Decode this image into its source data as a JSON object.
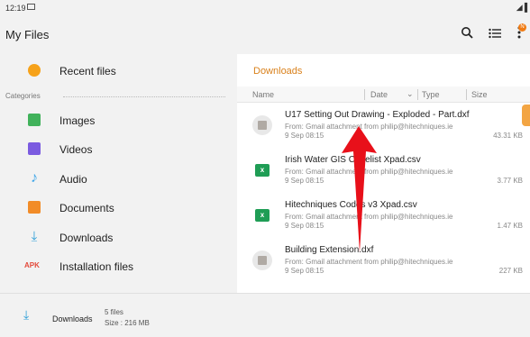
{
  "status": {
    "time": "12:19",
    "signal_text": "◢▐"
  },
  "appbar": {
    "title": "My Files",
    "notif_badge": "N"
  },
  "sidebar": {
    "items": [
      {
        "label": "Recent files",
        "icon": "clock-icon"
      },
      {
        "label": "Images",
        "icon": "image-icon"
      },
      {
        "label": "Videos",
        "icon": "play-icon"
      },
      {
        "label": "Audio",
        "icon": "music-note-icon"
      },
      {
        "label": "Documents",
        "icon": "document-icon"
      },
      {
        "label": "Downloads",
        "icon": "download-icon"
      },
      {
        "label": "Installation files",
        "icon": "apk-icon",
        "icon_text": "APK"
      }
    ],
    "categories_label": "Categories"
  },
  "content": {
    "breadcrumb": "Downloads",
    "columns": {
      "name": "Name",
      "date": "Date",
      "type": "Type",
      "size": "Size"
    },
    "files": [
      {
        "name": "U17 Setting Out Drawing - Exploded - Part.dxf",
        "source": "From: Gmail attachment from philip@hitechniques.ie",
        "date": "9 Sep 08:15",
        "size": "43.31 KB",
        "kind": "generic"
      },
      {
        "name": "Irish Water GIS Codelist Xpad.csv",
        "source": "From: Gmail attachment from philip@hitechniques.ie",
        "date": "9 Sep 08:15",
        "size": "3.77 KB",
        "kind": "spreadsheet"
      },
      {
        "name": "Hitechniques Codes v3 Xpad.csv",
        "source": "From: Gmail attachment from philip@hitechniques.ie",
        "date": "9 Sep 08:15",
        "size": "1.47 KB",
        "kind": "spreadsheet"
      },
      {
        "name": "Building Extension.dxf",
        "source": "From: Gmail attachment from philip@hitechniques.ie",
        "date": "9 Sep 08:15",
        "size": "227 KB",
        "kind": "generic"
      }
    ]
  },
  "bottom": {
    "label": "Downloads",
    "count": "5 files",
    "size": "Size : 216 MB"
  },
  "colors": {
    "accent": "#d9801b",
    "annotation_arrow": "#e8101a"
  }
}
